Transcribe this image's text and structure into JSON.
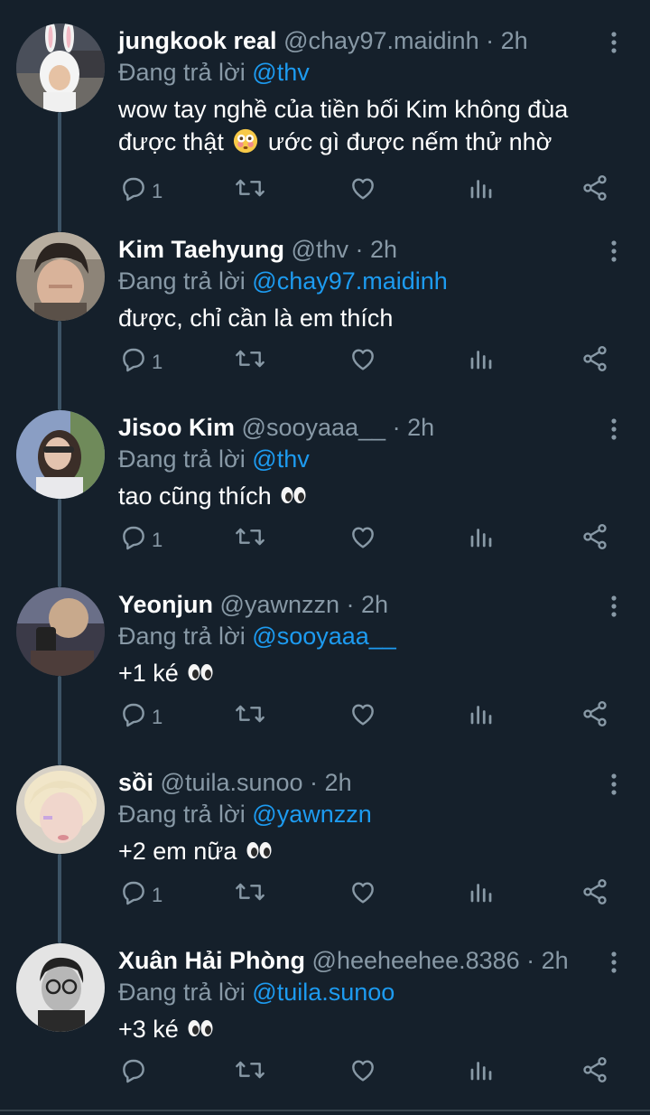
{
  "reply_prefix": "Đang trả lời",
  "colors": {
    "background": "#15202b",
    "mention": "#1d9bf0",
    "muted": "#8899a6",
    "thread_line": "#3d5466"
  },
  "tweets": [
    {
      "display_name": "jungkook real",
      "handle": "@chay97.maidinh",
      "time": "2h",
      "reply_to": "@thv",
      "text": "wow tay nghề của tiền bối Kim không đùa được thật",
      "text_emoji": "flushed-face-emoji",
      "text_after": "ước gì được nếm thử nhờ",
      "reply_count": "1",
      "avatar": "bunny-hood-avatar"
    },
    {
      "display_name": "Kim Taehyung",
      "handle": "@thv",
      "time": "2h",
      "reply_to": "@chay97.maidinh",
      "text": "được, chỉ cần là em thích",
      "reply_count": "1",
      "avatar": "selfie-avatar"
    },
    {
      "display_name": "Jisoo Kim",
      "handle": "@sooyaaa__",
      "time": "2h",
      "reply_to": "@thv",
      "text": "tao cũng thích",
      "text_emoji": "eyes-emoji",
      "reply_count": "1",
      "avatar": "girl-avatar"
    },
    {
      "display_name": "Yeonjun",
      "handle": "@yawnzzn",
      "time": "2h",
      "reply_to": "@sooyaaa__",
      "text": "+1 ké",
      "text_emoji": "eyes-emoji",
      "reply_count": "1",
      "avatar": "phone-avatar"
    },
    {
      "display_name": "sồi",
      "handle": "@tuila.sunoo",
      "time": "2h",
      "reply_to": "@yawnzzn",
      "text": "+2 em nữa",
      "text_emoji": "eyes-emoji",
      "reply_count": "1",
      "avatar": "blonde-avatar"
    },
    {
      "display_name": "Xuân Hải Phòng",
      "handle": "@heeheehee.8386",
      "time": "2h",
      "reply_to": "@tuila.sunoo",
      "text": "+3 ké",
      "text_emoji": "eyes-emoji",
      "reply_count": "",
      "avatar": "glasses-avatar"
    }
  ]
}
